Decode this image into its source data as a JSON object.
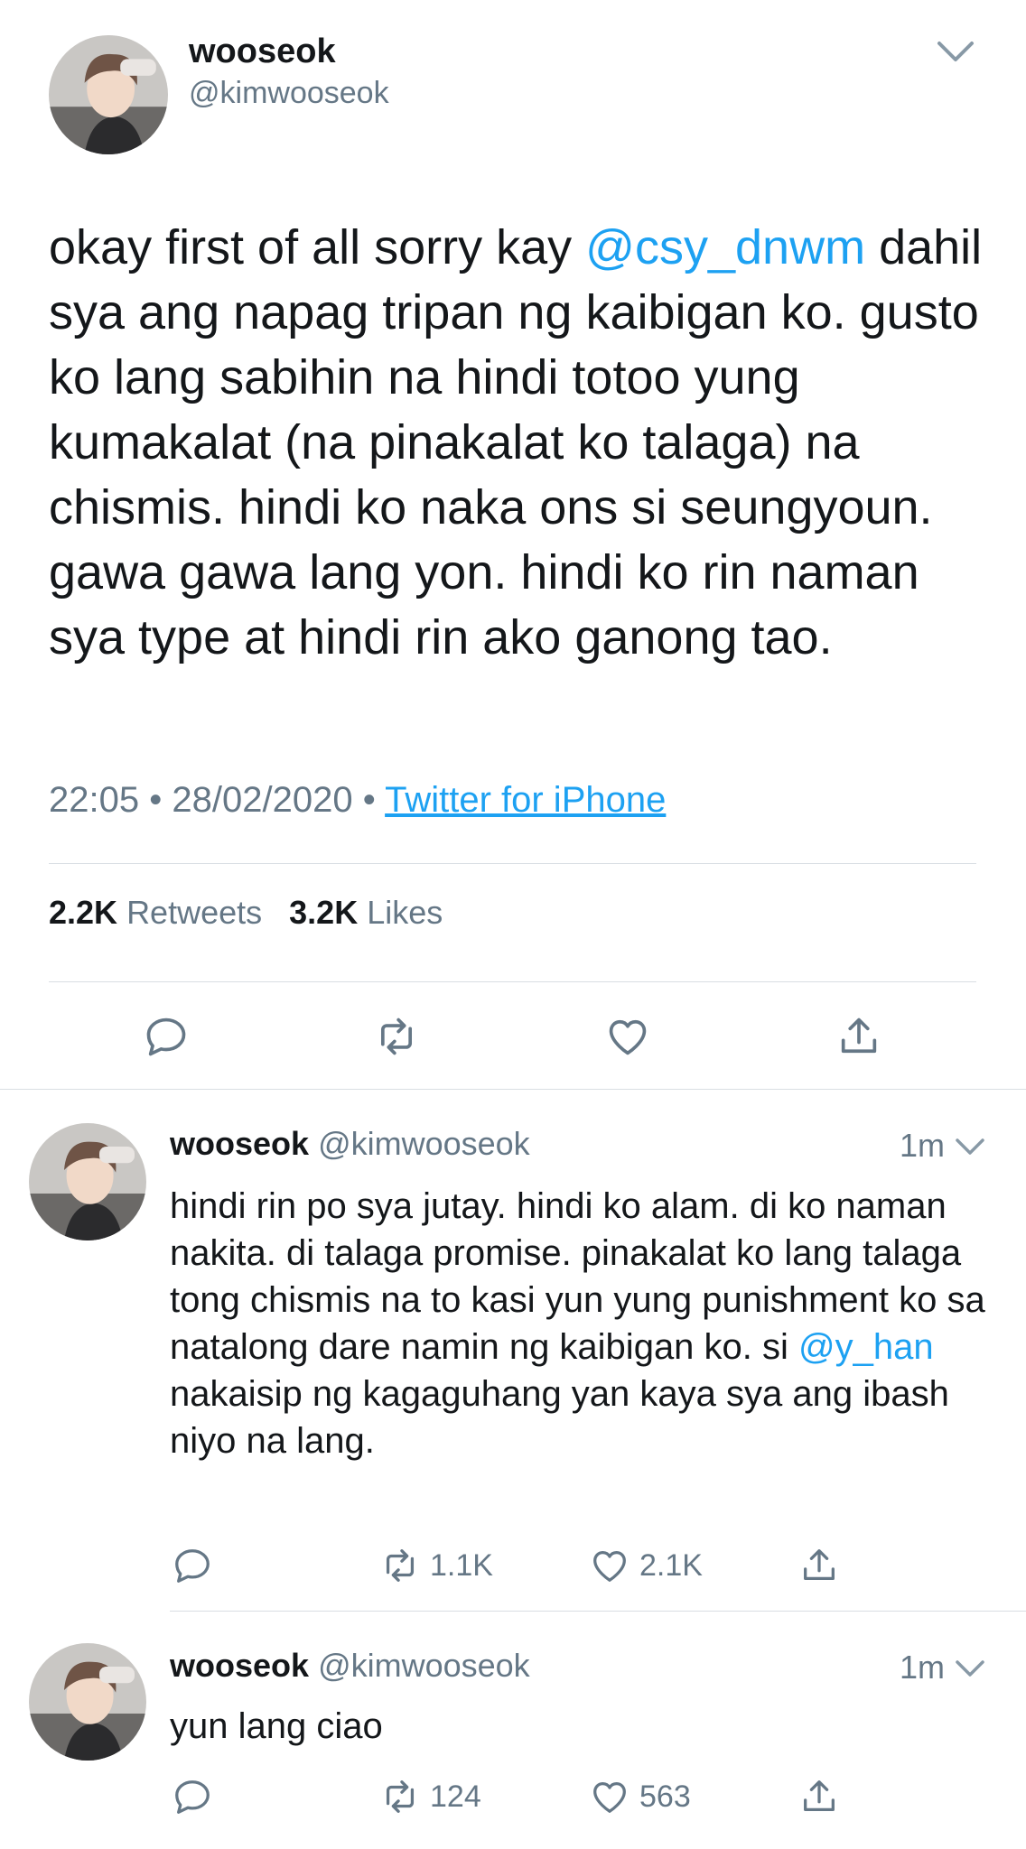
{
  "main_tweet": {
    "display_name": "wooseok",
    "handle": "@kimwooseok",
    "text_parts": {
      "before_mention": "okay first of all sorry kay ",
      "mention": "@csy_dnwm",
      "after_mention": " dahil sya ang napag tripan ng kaibigan ko. gusto ko lang sabihin na hindi totoo yung kumakalat (na pinakalat ko talaga) na chismis. hindi ko naka ons si seungyoun. gawa gawa lang yon. hindi ko rin naman sya type at hindi rin ako ganong tao."
    },
    "time": "22:05",
    "separator": "•",
    "date": "28/02/2020",
    "source": "Twitter for iPhone",
    "retweets_count": "2.2K",
    "retweets_label": "Retweets",
    "likes_count": "3.2K",
    "likes_label": "Likes"
  },
  "replies": [
    {
      "display_name": "wooseok",
      "handle": "@kimwooseok",
      "time": "1m",
      "text_parts": {
        "before_mention": "hindi rin po sya jutay. hindi ko alam. di ko naman nakita. di talaga promise. pinakalat ko lang talaga tong chismis na to kasi yun yung punishment ko sa natalong dare namin ng kaibigan ko. si ",
        "mention": "@y_han",
        "after_mention": " nakaisip ng kagaguhang yan kaya sya ang ibash niyo na lang."
      },
      "retweets": "1.1K",
      "likes": "2.1K"
    },
    {
      "display_name": "wooseok",
      "handle": "@kimwooseok",
      "time": "1m",
      "text_parts": {
        "before_mention": "yun lang ciao",
        "mention": "",
        "after_mention": ""
      },
      "retweets": "124",
      "likes": "563"
    }
  ],
  "icons": {
    "reply": "reply-icon",
    "retweet": "retweet-icon",
    "like": "heart-icon",
    "share": "share-icon",
    "caret": "chevron-down-icon"
  },
  "colors": {
    "accent": "#1da1f2",
    "secondary_text": "#657786",
    "primary_text": "#14171a",
    "divider": "#d9dee3"
  }
}
